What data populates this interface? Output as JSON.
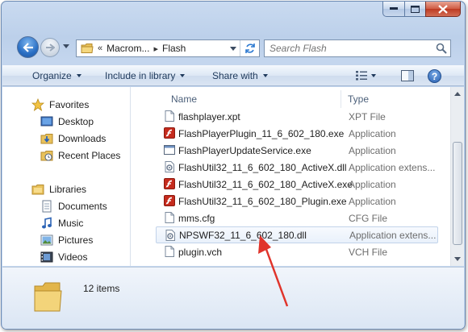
{
  "address": {
    "overflow": "«",
    "crumbs": [
      "Macrom...",
      "Flash"
    ]
  },
  "search": {
    "placeholder": "Search Flash"
  },
  "toolbar": {
    "organize": "Organize",
    "include_in_library": "Include in library",
    "share_with": "Share with",
    "help": "?"
  },
  "sidebar": {
    "favorites": "Favorites",
    "desktop": "Desktop",
    "downloads": "Downloads",
    "recent_places": "Recent Places",
    "libraries": "Libraries",
    "documents": "Documents",
    "music": "Music",
    "pictures": "Pictures",
    "videos": "Videos"
  },
  "columns": {
    "name": "Name",
    "type": "Type"
  },
  "files": [
    {
      "name": "flashplayer.xpt",
      "type": "XPT File",
      "icon": "generic-file-icon"
    },
    {
      "name": "FlashPlayerPlugin_11_6_602_180.exe",
      "type": "Application",
      "icon": "flash-icon"
    },
    {
      "name": "FlashPlayerUpdateService.exe",
      "type": "Application",
      "icon": "window-app-icon"
    },
    {
      "name": "FlashUtil32_11_6_602_180_ActiveX.dll",
      "type": "Application extens...",
      "icon": "dll-gear-icon"
    },
    {
      "name": "FlashUtil32_11_6_602_180_ActiveX.exe",
      "type": "Application",
      "icon": "flash-icon"
    },
    {
      "name": "FlashUtil32_11_6_602_180_Plugin.exe",
      "type": "Application",
      "icon": "flash-icon"
    },
    {
      "name": "mms.cfg",
      "type": "CFG File",
      "icon": "generic-file-icon"
    },
    {
      "name": "NPSWF32_11_6_602_180.dll",
      "type": "Application extens...",
      "icon": "dll-gear-icon",
      "selected": true
    },
    {
      "name": "plugin.vch",
      "type": "VCH File",
      "icon": "generic-file-icon"
    }
  ],
  "details": {
    "count": "12 items"
  },
  "colors": {
    "accent": "#3a7bd5",
    "annotation_arrow": "#e0342b",
    "selection": "#e9f1fb"
  }
}
